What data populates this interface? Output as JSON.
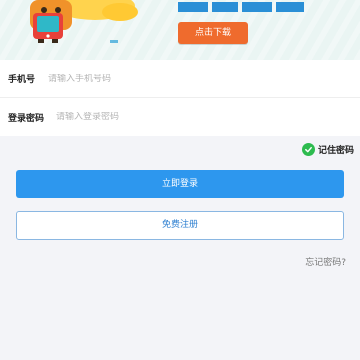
{
  "banner": {
    "download_label": "点击下载",
    "title_visible": "",
    "accent_color": "#ef6b2d"
  },
  "form": {
    "phone_label": "手机号",
    "phone_placeholder": "请输入手机号码",
    "password_label": "登录密码",
    "password_placeholder": "请输入登录密码"
  },
  "remember": {
    "label": "记住密码",
    "checked": true
  },
  "actions": {
    "login_label": "立即登录",
    "register_label": "免费注册",
    "forgot_label": "忘记密码?"
  },
  "colors": {
    "primary": "#2d97ee",
    "check": "#2dbb4f"
  }
}
